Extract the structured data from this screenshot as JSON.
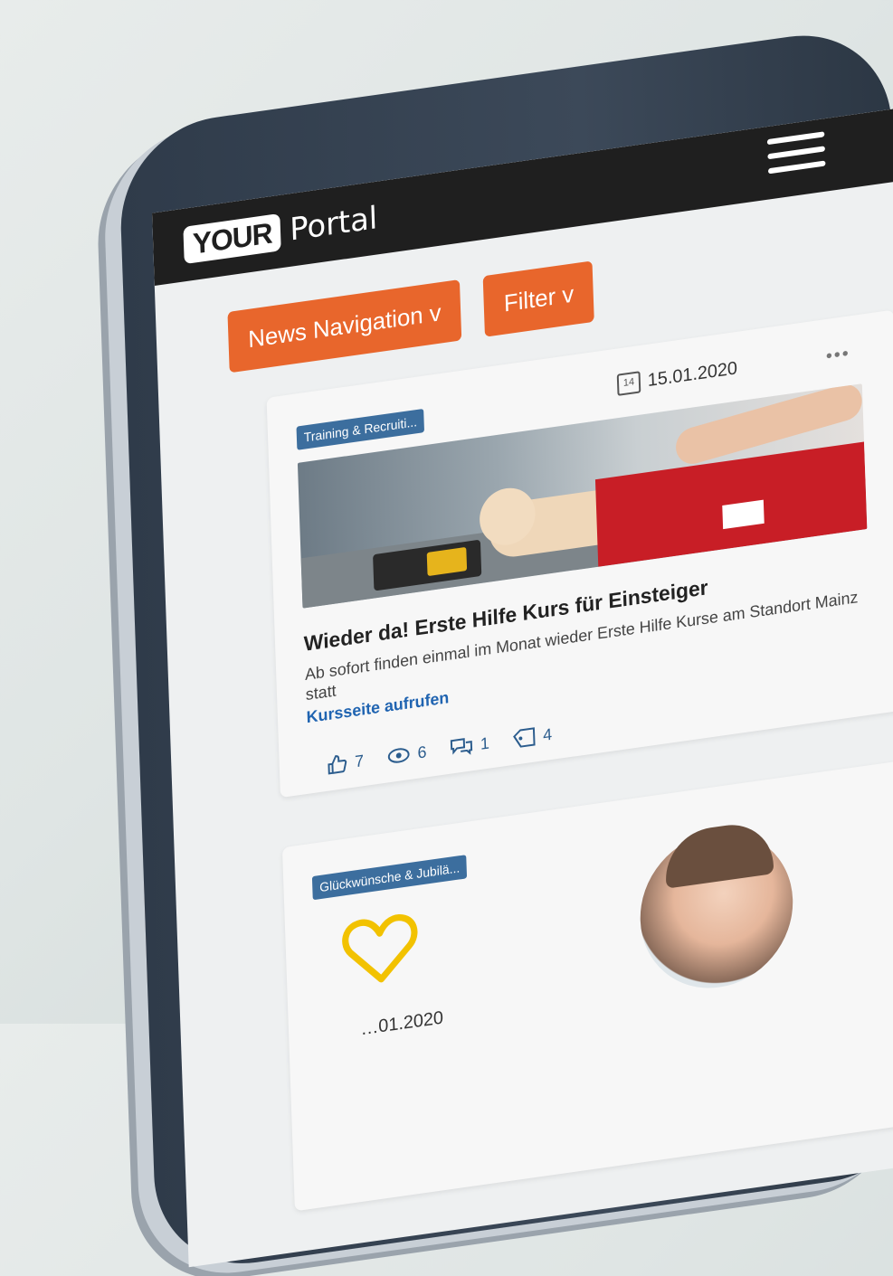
{
  "portal": {
    "brand_box": "YOUR",
    "brand_text": "Portal"
  },
  "toolbar": {
    "news_nav_label": "News Navigation",
    "news_nav_chevron": "v",
    "filter_label": "Filter",
    "filter_chevron": "v"
  },
  "news": [
    {
      "category": "Training & Recruiti...",
      "date": "15.01.2020",
      "calendar_day": "14",
      "more": "•••",
      "title": "Wieder da! Erste Hilfe Kurs für Einsteiger",
      "description": "Ab sofort finden einmal im Monat wieder Erste Hilfe Kurse am Standort Mainz statt",
      "link": "Kursseite aufrufen",
      "stats": {
        "likes": "7",
        "views": "6",
        "comments": "1",
        "tags": "4"
      },
      "icons": [
        "thumbs-up-icon",
        "eye-icon",
        "comment-icon",
        "tag-icon"
      ]
    },
    {
      "category": "Glückwünsche & Jubilä...",
      "date": "…01.2020",
      "icon": "heart-icon",
      "accent": "#f2c200"
    }
  ],
  "colors": {
    "orange": "#e8662c",
    "tag_blue": "#3c6e9e",
    "link_blue": "#2064b1",
    "topbar": "#1f1f1f"
  }
}
